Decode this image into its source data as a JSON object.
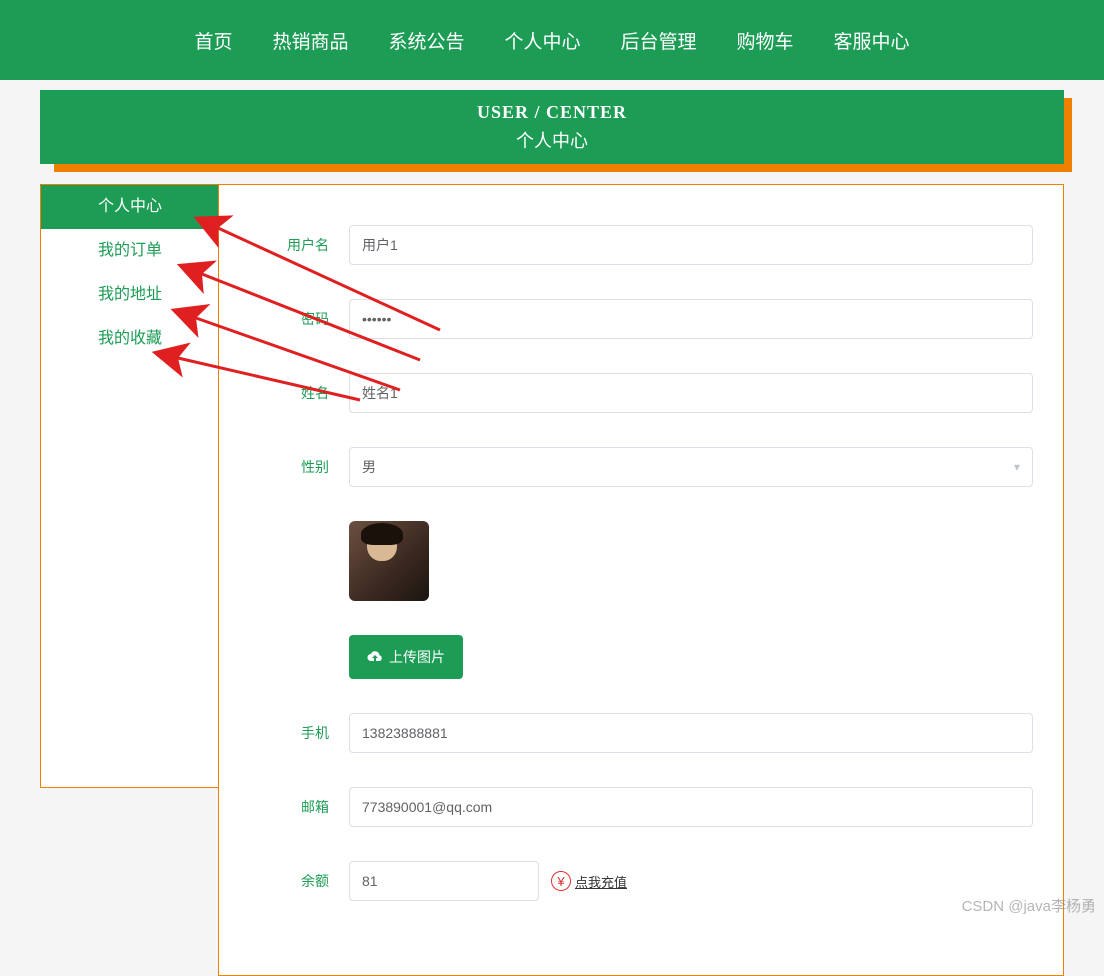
{
  "nav": [
    "首页",
    "热销商品",
    "系统公告",
    "个人中心",
    "后台管理",
    "购物车",
    "客服中心"
  ],
  "banner": {
    "en": "USER / CENTER",
    "zh": "个人中心"
  },
  "sidebar": {
    "items": [
      {
        "label": "个人中心",
        "active": true
      },
      {
        "label": "我的订单",
        "active": false
      },
      {
        "label": "我的地址",
        "active": false
      },
      {
        "label": "我的收藏",
        "active": false
      }
    ]
  },
  "form": {
    "username": {
      "label": "用户名",
      "value": "用户1"
    },
    "password": {
      "label": "密码",
      "value": "••••••"
    },
    "realname": {
      "label": "姓名",
      "value": "姓名1"
    },
    "gender": {
      "label": "性别",
      "value": "男"
    },
    "upload_label": "上传图片",
    "phone": {
      "label": "手机",
      "value": "13823888881"
    },
    "email": {
      "label": "邮箱",
      "value": "773890001@qq.com"
    },
    "balance": {
      "label": "余额",
      "value": "81",
      "recharge": "点我充值"
    }
  },
  "watermark": "CSDN @java李杨勇"
}
